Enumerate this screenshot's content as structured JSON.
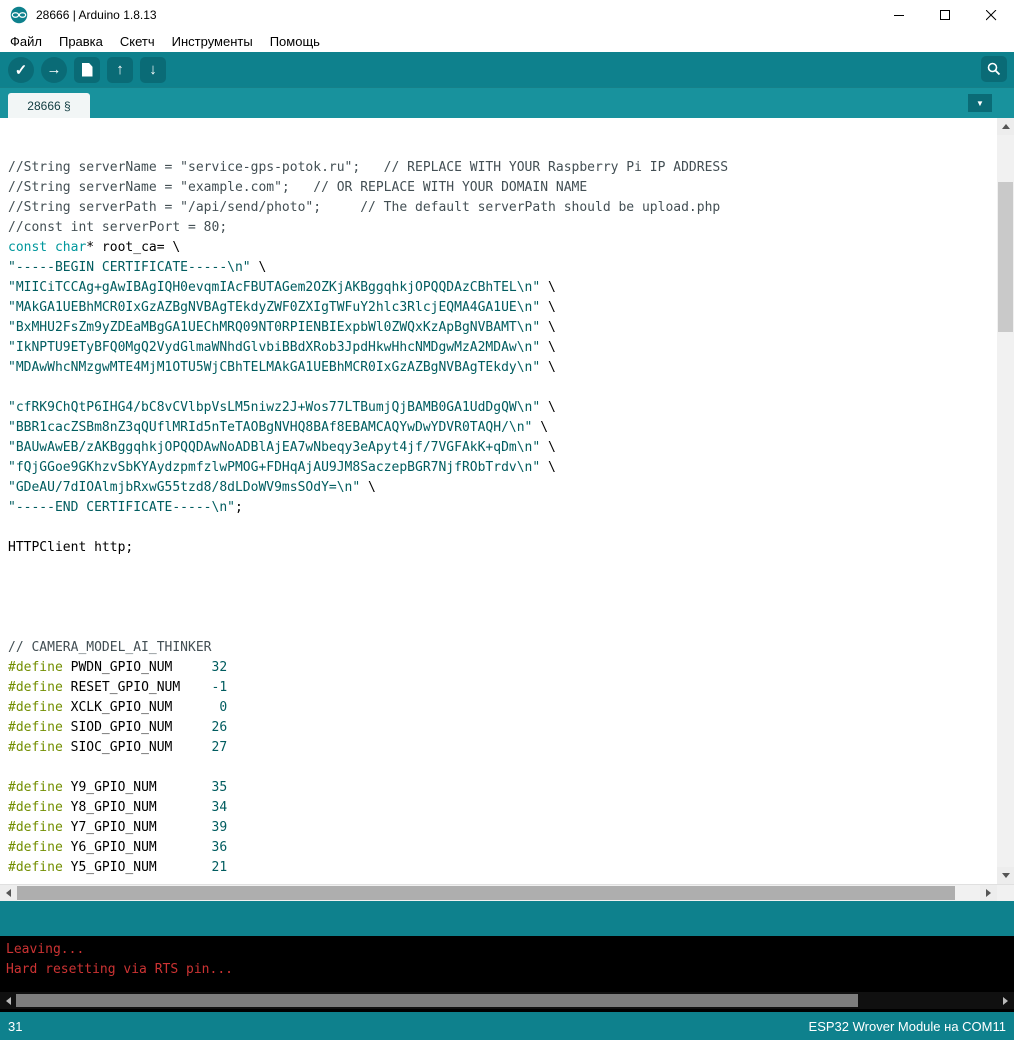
{
  "colors": {
    "teal": "#0e818d",
    "teal-light": "#18929d",
    "teal-dark": "#0a6b76",
    "editor-bg": "#ffffff",
    "console-bg": "#000000",
    "console-error": "#cc3333",
    "code-plain": "#000000",
    "code-comment": "#434f54",
    "code-keyword": "#00979c",
    "code-string": "#005c5f",
    "code-define": "#728e00",
    "code-number": "#005c5f",
    "tab-active-bg": "#f2f6f6"
  },
  "win": {
    "title": "28666 | Arduino 1.8.13"
  },
  "menubar": {
    "items": [
      "Файл",
      "Правка",
      "Скетч",
      "Инструменты",
      "Помощь"
    ]
  },
  "toolbar": {
    "buttons": [
      "verify",
      "upload",
      "new",
      "open",
      "save"
    ],
    "serial_monitor": "serial-monitor"
  },
  "icons": {
    "verify": "✓",
    "upload": "→",
    "open": "↑",
    "save": "↓",
    "dropdown": "▼"
  },
  "tabs": {
    "active": "28666 §"
  },
  "editor": {
    "lines": [
      [],
      [],
      [
        {
          "t": "//String serverName = \"service-gps-potok.ru\";   // REPLACE WITH YOUR Raspberry Pi IP ADDRESS",
          "c": "cm"
        }
      ],
      [
        {
          "t": "//String serverName = \"example.com\";   // OR REPLACE WITH YOUR DOMAIN NAME",
          "c": "cm"
        }
      ],
      [
        {
          "t": "//String serverPath = \"/api/send/photo\";     // The default serverPath should be upload.php",
          "c": "cm"
        }
      ],
      [
        {
          "t": "//const int serverPort = 80;",
          "c": "cm"
        }
      ],
      [
        {
          "t": "const",
          "c": "kw"
        },
        {
          "t": " ",
          "c": "pl"
        },
        {
          "t": "char",
          "c": "kw"
        },
        {
          "t": "* root_ca= \\",
          "c": "pl"
        }
      ],
      [
        {
          "t": "\"-----BEGIN CERTIFICATE-----\\n\"",
          "c": "st"
        },
        {
          "t": " \\",
          "c": "pl"
        }
      ],
      [
        {
          "t": "\"MIICiTCCAg+gAwIBAgIQH0evqmIAcFBUTAGem2OZKjAKBggqhkjOPQQDAzCBhTEL\\n\"",
          "c": "st"
        },
        {
          "t": " \\",
          "c": "pl"
        }
      ],
      [
        {
          "t": "\"MAkGA1UEBhMCR0IxGzAZBgNVBAgTEkdyZWF0ZXIgTWFuY2hlc3RlcjEQMA4GA1UE\\n\"",
          "c": "st"
        },
        {
          "t": " \\",
          "c": "pl"
        }
      ],
      [
        {
          "t": "\"BxMHU2FsZm9yZDEaMBgGA1UEChMRQ09NT0RPIENBIExpbWl0ZWQxKzApBgNVBAMT\\n\"",
          "c": "st"
        },
        {
          "t": " \\",
          "c": "pl"
        }
      ],
      [
        {
          "t": "\"IkNPTU9ETyBFQ0MgQ2VydGlmaWNhdGlvbiBBdXRob3JpdHkwHhcNMDgwMzA2MDAw\\n\"",
          "c": "st"
        },
        {
          "t": " \\",
          "c": "pl"
        }
      ],
      [
        {
          "t": "\"MDAwWhcNMzgwMTE4MjM1OTU5WjCBhTELMAkGA1UEBhMCR0IxGzAZBgNVBAgTEkdy\\n\"",
          "c": "st"
        },
        {
          "t": " \\",
          "c": "pl"
        }
      ],
      [],
      [
        {
          "t": "\"cfRK9ChQtP6IHG4/bC8vCVlbpVsLM5niwz2J+Wos77LTBumjQjBAMB0GA1UdDgQW\\n\"",
          "c": "st"
        },
        {
          "t": " \\",
          "c": "pl"
        }
      ],
      [
        {
          "t": "\"BBR1cacZSBm8nZ3qQUflMRId5nTeTAOBgNVHQ8BAf8EBAMCAQYwDwYDVR0TAQH/\\n\"",
          "c": "st"
        },
        {
          "t": " \\",
          "c": "pl"
        }
      ],
      [
        {
          "t": "\"BAUwAwEB/zAKBggqhkjOPQQDAwNoADBlAjEA7wNbeqy3eApyt4jf/7VGFAkK+qDm\\n\"",
          "c": "st"
        },
        {
          "t": " \\",
          "c": "pl"
        }
      ],
      [
        {
          "t": "\"fQjGGoe9GKhzvSbKYAydzpmfzlwPMOG+FDHqAjAU9JM8SaczepBGR7NjfRObTrdv\\n\"",
          "c": "st"
        },
        {
          "t": " \\",
          "c": "pl"
        }
      ],
      [
        {
          "t": "\"GDeAU/7dIOAlmjbRxwG55tzd8/8dLDoWV9msSOdY=\\n\"",
          "c": "st"
        },
        {
          "t": " \\",
          "c": "pl"
        }
      ],
      [
        {
          "t": "\"-----END CERTIFICATE-----\\n\"",
          "c": "st"
        },
        {
          "t": ";",
          "c": "pl"
        }
      ],
      [],
      [
        {
          "t": "HTTPClient http;",
          "c": "pl"
        }
      ],
      [],
      [],
      [],
      [],
      [
        {
          "t": "// CAMERA_MODEL_AI_THINKER",
          "c": "cm"
        }
      ],
      [
        {
          "t": "#define",
          "c": "df"
        },
        {
          "t": " PWDN_GPIO_NUM     ",
          "c": "pl"
        },
        {
          "t": "32",
          "c": "nm"
        }
      ],
      [
        {
          "t": "#define",
          "c": "df"
        },
        {
          "t": " RESET_GPIO_NUM    ",
          "c": "pl"
        },
        {
          "t": "-1",
          "c": "nm"
        }
      ],
      [
        {
          "t": "#define",
          "c": "df"
        },
        {
          "t": " XCLK_GPIO_NUM      ",
          "c": "pl"
        },
        {
          "t": "0",
          "c": "nm"
        }
      ],
      [
        {
          "t": "#define",
          "c": "df"
        },
        {
          "t": " SIOD_GPIO_NUM     ",
          "c": "pl"
        },
        {
          "t": "26",
          "c": "nm"
        }
      ],
      [
        {
          "t": "#define",
          "c": "df"
        },
        {
          "t": " SIOC_GPIO_NUM     ",
          "c": "pl"
        },
        {
          "t": "27",
          "c": "nm"
        }
      ],
      [],
      [
        {
          "t": "#define",
          "c": "df"
        },
        {
          "t": " Y9_GPIO_NUM       ",
          "c": "pl"
        },
        {
          "t": "35",
          "c": "nm"
        }
      ],
      [
        {
          "t": "#define",
          "c": "df"
        },
        {
          "t": " Y8_GPIO_NUM       ",
          "c": "pl"
        },
        {
          "t": "34",
          "c": "nm"
        }
      ],
      [
        {
          "t": "#define",
          "c": "df"
        },
        {
          "t": " Y7_GPIO_NUM       ",
          "c": "pl"
        },
        {
          "t": "39",
          "c": "nm"
        }
      ],
      [
        {
          "t": "#define",
          "c": "df"
        },
        {
          "t": " Y6_GPIO_NUM       ",
          "c": "pl"
        },
        {
          "t": "36",
          "c": "nm"
        }
      ],
      [
        {
          "t": "#define",
          "c": "df"
        },
        {
          "t": " Y5_GPIO_NUM       ",
          "c": "pl"
        },
        {
          "t": "21",
          "c": "nm"
        }
      ]
    ]
  },
  "console": {
    "lines": [
      "Leaving...",
      "Hard resetting via RTS pin..."
    ]
  },
  "statusbar": {
    "line_number": "31",
    "board": "ESP32 Wrover Module на COM11"
  }
}
